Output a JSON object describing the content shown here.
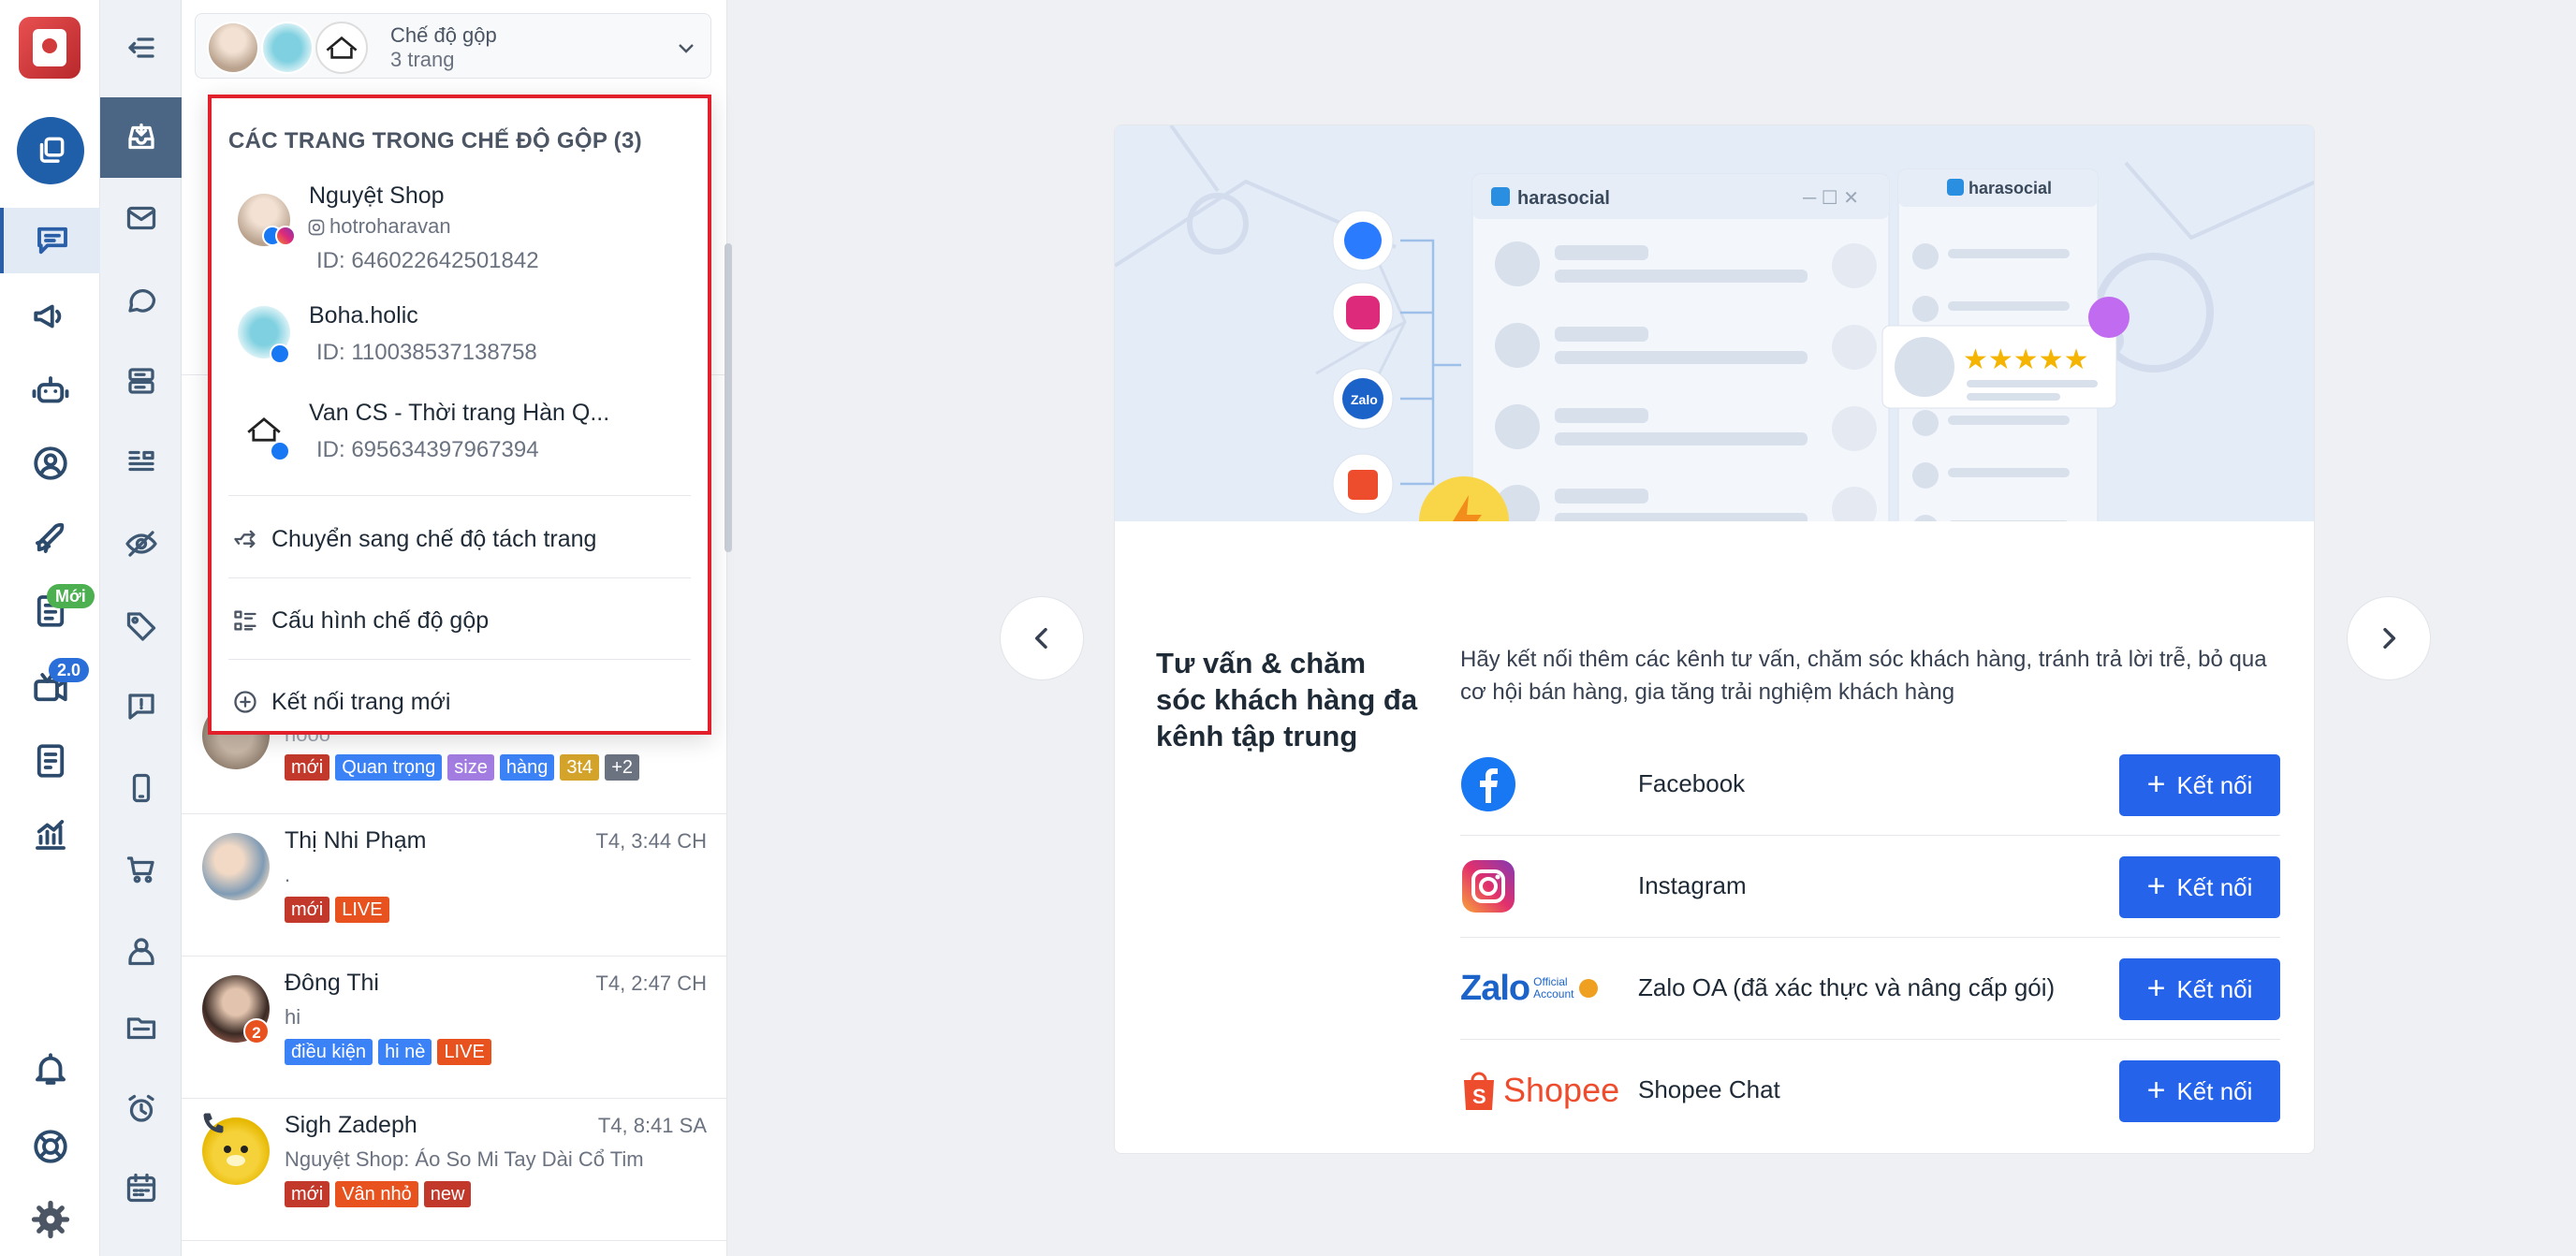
{
  "rail": {
    "badge_new": "Mới",
    "badge_version": "2.0"
  },
  "page_selector": {
    "title": "Chế độ gộp",
    "subtitle": "3 trang"
  },
  "dropdown": {
    "title": "CÁC TRANG TRONG CHẾ ĐỘ GỘP (3)",
    "pages": [
      {
        "name": "Nguyệt Shop",
        "handle": "hotroharavan",
        "id": "ID: 646022642501842"
      },
      {
        "name": "Boha.holic",
        "id": "ID: 110038537138758"
      },
      {
        "name": "Van CS - Thời trang Hàn Q...",
        "id": "ID: 695634397967394"
      }
    ],
    "actions": {
      "switch": "Chuyển sang chế độ tách trang",
      "config": "Cấu hình chế độ gộp",
      "connect": "Kết nối trang mới"
    }
  },
  "conversations": [
    {
      "msg": "nooo",
      "tags": [
        "mới",
        "Quan trọng",
        "size",
        "hàng",
        "3t4",
        "+2"
      ],
      "colors": [
        "#c2392b",
        "#3b82f6",
        "#a27ce0",
        "#3b82f6",
        "#d4a32a",
        "#6b7280"
      ]
    },
    {
      "name": "Thị Nhi Phạm",
      "time": "T4, 3:44 CH",
      "msg": ".",
      "tags": [
        "mới",
        "LIVE"
      ],
      "colors": [
        "#c2392b",
        "#e8521f"
      ]
    },
    {
      "name": "Đông Thi",
      "time": "T4, 2:47 CH",
      "msg": "hi",
      "unread": "2",
      "tags": [
        "điều kiện",
        "hi nè",
        "LIVE"
      ],
      "colors": [
        "#3b82f6",
        "#3b82f6",
        "#e8521f"
      ]
    },
    {
      "name": "Sigh Zadeph",
      "time": "T4, 8:41 SA",
      "msg": "Nguyệt Shop: Áo So Mi Tay Dài Cổ Tim",
      "tags": [
        "mới",
        "Vân nhỏ",
        "new"
      ],
      "colors": [
        "#c2392b",
        "#e8521f",
        "#c2392b"
      ]
    }
  ],
  "hero": {
    "brand": "harasocial",
    "brand2": "harasocial",
    "zalo_label": "Zalo"
  },
  "card": {
    "heading": "Tư vấn & chăm sóc khách hàng đa kênh tập trung",
    "description": "Hãy kết nối thêm các kênh tư vấn, chăm sóc khách hàng, tránh trả lời trễ, bỏ qua cơ hội bán hàng, gia tăng trải nghiệm khách hàng",
    "connect_label": "Kết nối",
    "channels": [
      {
        "name": "Facebook",
        "icon": "facebook-icon"
      },
      {
        "name": "Instagram",
        "icon": "instagram-icon"
      },
      {
        "name": "Zalo OA (đã xác thực và nâng cấp gói)",
        "icon": "zalo-oa-logo",
        "logo_word": "Zalo",
        "logo_small_1": "Official",
        "logo_small_2": "Account"
      },
      {
        "name": "Shopee Chat",
        "icon": "shopee-logo",
        "logo_word": "Shopee"
      }
    ]
  }
}
